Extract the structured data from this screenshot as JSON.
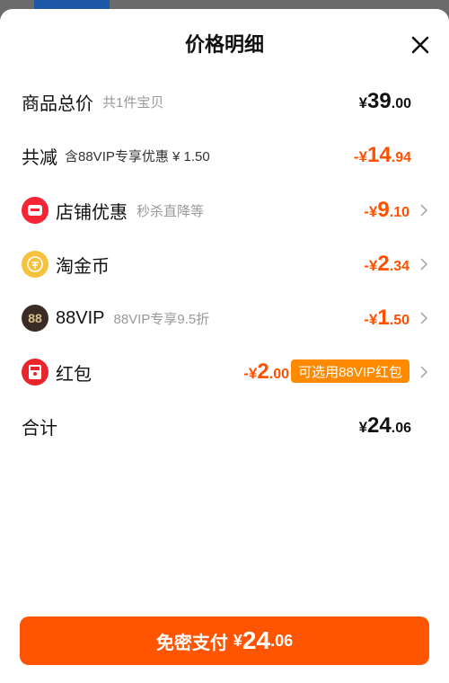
{
  "header": {
    "title": "价格明细"
  },
  "rows": {
    "total": {
      "label": "商品总价",
      "sub": "共1件宝贝",
      "yen": "¥",
      "int": "39",
      "dec": ".00"
    },
    "reduce": {
      "label": "共减",
      "sub": "含88VIP专享优惠 ¥ 1.50",
      "sign": "-¥",
      "int": "14",
      "dec": ".94"
    },
    "shop": {
      "label": "店铺优惠",
      "sub": "秒杀直降等",
      "sign": "-¥",
      "int": "9",
      "dec": ".10"
    },
    "coin": {
      "label": "淘金币",
      "sign": "-¥",
      "int": "2",
      "dec": ".34"
    },
    "vip": {
      "label": "88VIP",
      "sub": "88VIP专享9.5折",
      "icon_text": "88",
      "sign": "-¥",
      "int": "1",
      "dec": ".50"
    },
    "redpack": {
      "label": "红包",
      "sign": "-¥",
      "int": "2",
      "dec": ".00",
      "badge": "可选用88VIP红包"
    },
    "sum": {
      "label": "合计",
      "yen": "¥",
      "int": "24",
      "dec": ".06"
    }
  },
  "pay_button": {
    "label": "免密支付",
    "yen": "¥",
    "int": "24",
    "dec": ".06"
  },
  "icons": {
    "close": "close-icon",
    "shop": "shop-icon",
    "coin": "coin-icon",
    "vip": "vip-88-icon",
    "redpack": "red-packet-icon",
    "arrow": "chevron-right-icon"
  },
  "colors": {
    "accent": "#ff5000",
    "badge": "#ff8a00",
    "pay_button": "#ff5500"
  }
}
